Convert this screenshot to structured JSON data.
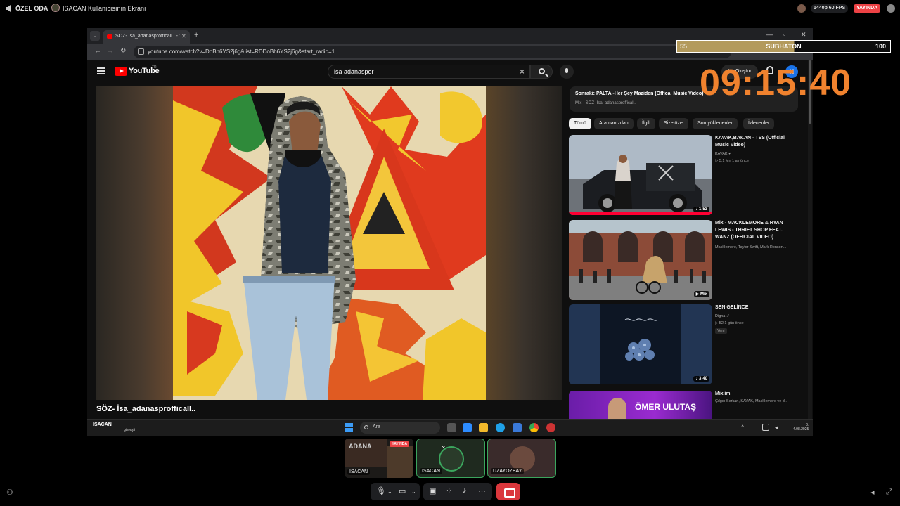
{
  "discord": {
    "room_name": "ÖZEL ODA",
    "separator": "›",
    "screen_title": "ISACAN Kullanıcısının Ekranı",
    "stream_quality": "1440p 60 FPS",
    "live_badge": "YAYINDA",
    "participants": [
      {
        "name": "ISACAN",
        "live_badge": "YAYINDA"
      },
      {
        "name": "ISACAN"
      },
      {
        "name": "UZAYOZBAY"
      }
    ],
    "accent_color": "#3ba55d",
    "danger_color": "#ed4245"
  },
  "overlay": {
    "subathon_left": "55",
    "subathon_label": "SUBHATON",
    "subathon_right": "100",
    "subathon_progress": 0.55,
    "clock": "09:15:40",
    "clock_color": "#f0822e"
  },
  "browser": {
    "tab_title": "SÖZ- İsa_adanasprofficall.. - YouTube",
    "url": "youtube.com/watch?v=DoBh6YS2j6g&list=RDDoBh6YS2j6g&start_radio=1"
  },
  "youtube": {
    "logo_text": "YouTube",
    "region": "TR",
    "search_query": "isa adanaspor",
    "create_label": "Oluştur",
    "account_initial": "H",
    "video_title": "SÖZ- İsa_adanasprofficall..",
    "up_next": {
      "title": "Sonraki: PALTA -Her Şey Maziden (Offical Music Video)",
      "sub": "Mix - SÖZ- İsa_adanasproffical.."
    },
    "chips": [
      "Tümü",
      "Aramanızdan",
      "İlgili",
      "Size özel",
      "Son yüklenenler",
      "İzlenenler"
    ],
    "recommendations": [
      {
        "title": "KAVAK,BAKAN - TSS (Official Music Video)",
        "channel": "KAVAK ✔",
        "meta": "▷ 5,1 Mn  1 ay önce",
        "duration": "♪ 1:53"
      },
      {
        "title": "Mix - MACKLEMORE & RYAN LEWIS - THRIFT SHOP FEAT. WANZ (OFFICIAL VIDEO)",
        "channel": "Macklemore, Taylor Swift, Mark Ronson...",
        "meta": "",
        "duration": "▶ Mix"
      },
      {
        "title": "SEN GELİNCE",
        "channel": "Digna ✔",
        "meta": "▷ 52  1 gün önce",
        "badge": "Yeni",
        "duration": "♪ 3:40"
      },
      {
        "title": "Mix'im",
        "channel": "Çılgın Serkan, KAVAK, Macklemore ve d...",
        "meta": "",
        "thumb_text": "ÖMER ULUTAŞ"
      }
    ]
  },
  "taskbar": {
    "user": "ISACAN",
    "weather": "güneşli",
    "search_label": "Ara",
    "time": "0:",
    "date": "4.08.2025"
  }
}
